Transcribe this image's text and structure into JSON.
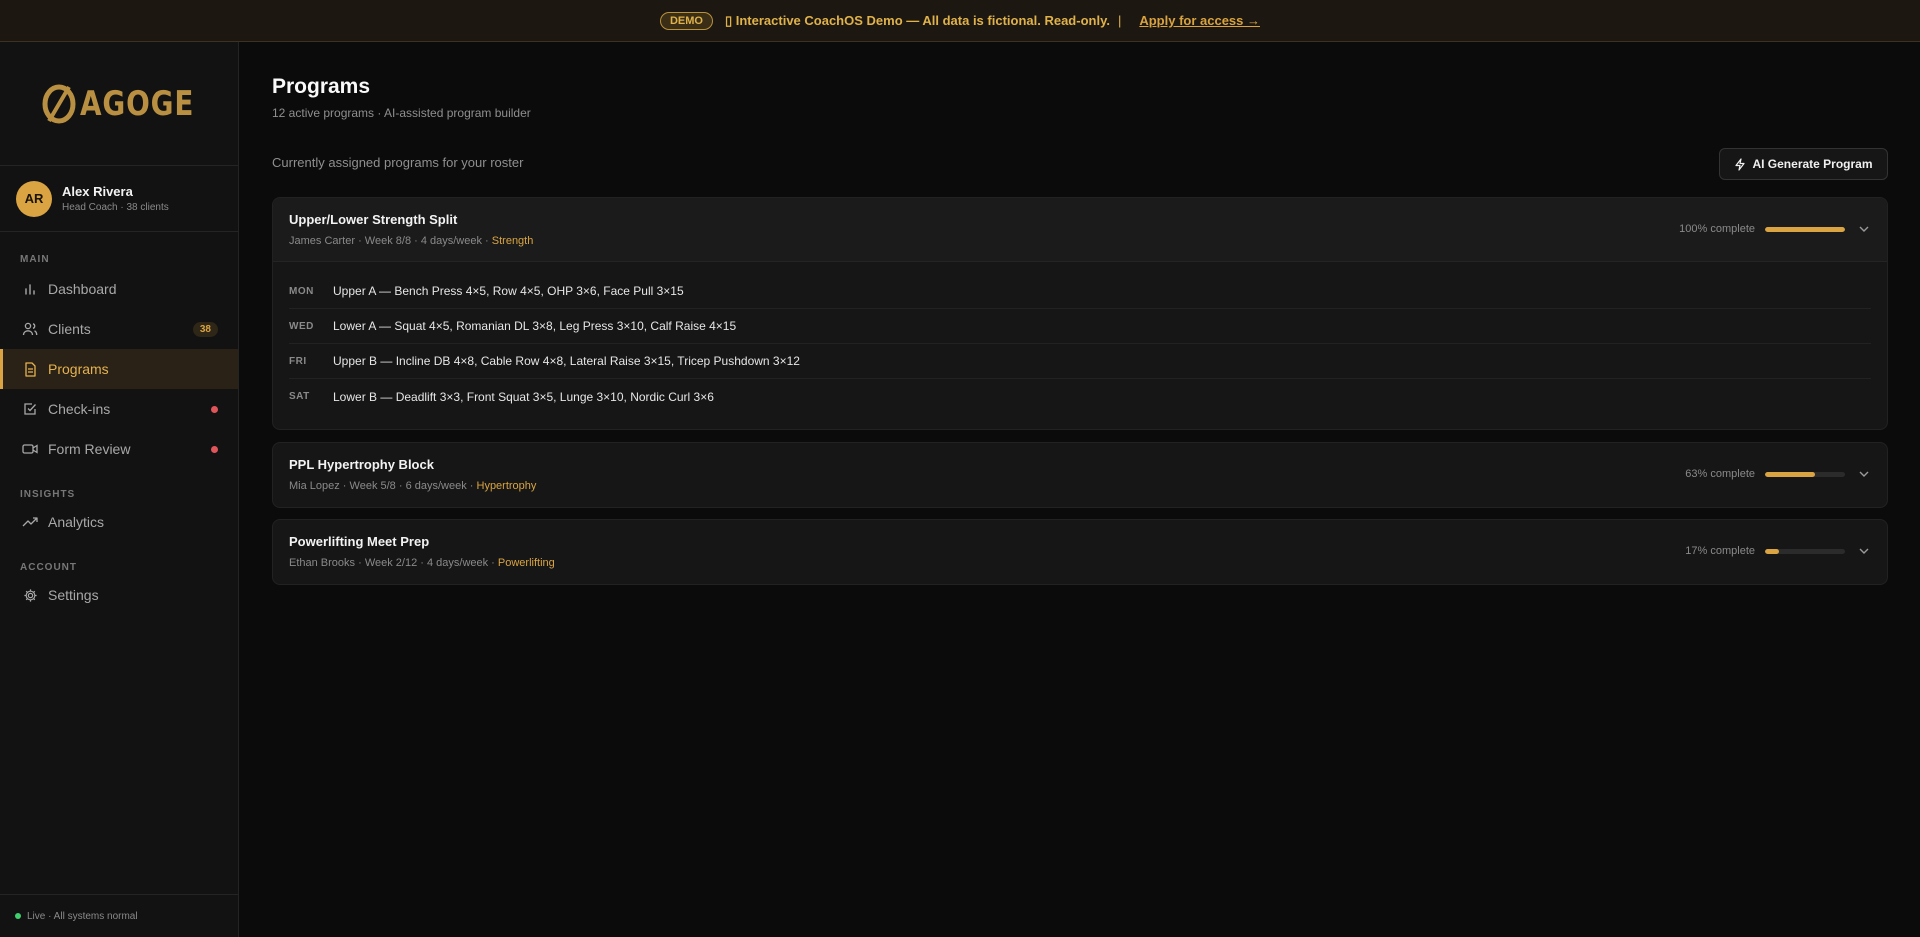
{
  "banner": {
    "badge": "DEMO",
    "message": "⁠▯ Interactive CoachOS Demo — All data is fictional. Read-only.",
    "separator": "|",
    "link": "Apply for access →"
  },
  "brand": {
    "logo_text": "AGOGE"
  },
  "user": {
    "initials": "AR",
    "name": "Alex Rivera",
    "role": "Head Coach · 38 clients"
  },
  "nav": {
    "main_label": "MAIN",
    "dashboard": "Dashboard",
    "clients": "Clients",
    "clients_count": "38",
    "programs": "Programs",
    "checkins": "Check-ins",
    "form_review": "Form Review",
    "insights_label": "INSIGHTS",
    "analytics": "Analytics",
    "account_label": "ACCOUNT",
    "settings": "Settings"
  },
  "status": {
    "text": "Live · All systems normal"
  },
  "page": {
    "title": "Programs",
    "subtitle": "12 active programs · AI-assisted program builder",
    "caption": "Currently assigned programs for your roster",
    "ai_button": "AI Generate Program"
  },
  "programs": [
    {
      "title": "Upper/Lower Strength Split",
      "meta": "James Carter · Week 8/8 · 4 days/week · ",
      "tag": "Strength",
      "progress_label": "100% complete",
      "progress_pct": 100,
      "days": [
        {
          "day": "MON",
          "plan": "Upper A — Bench Press 4×5, Row 4×5, OHP 3×6, Face Pull 3×15"
        },
        {
          "day": "WED",
          "plan": "Lower A — Squat 4×5, Romanian DL 3×8, Leg Press 3×10, Calf Raise 4×15"
        },
        {
          "day": "FRI",
          "plan": "Upper B — Incline DB 4×8, Cable Row 4×8, Lateral Raise 3×15, Tricep Pushdown 3×12"
        },
        {
          "day": "SAT",
          "plan": "Lower B — Deadlift 3×3, Front Squat 3×5, Lunge 3×10, Nordic Curl 3×6"
        }
      ]
    },
    {
      "title": "PPL Hypertrophy Block",
      "meta": "Mia Lopez · Week 5/8 · 6 days/week · ",
      "tag": "Hypertrophy",
      "progress_label": "63% complete",
      "progress_pct": 63
    },
    {
      "title": "Powerlifting Meet Prep",
      "meta": "Ethan Brooks · Week 2/12 · 4 days/week · ",
      "tag": "Powerlifting",
      "progress_label": "17% complete",
      "progress_pct": 17
    }
  ]
}
